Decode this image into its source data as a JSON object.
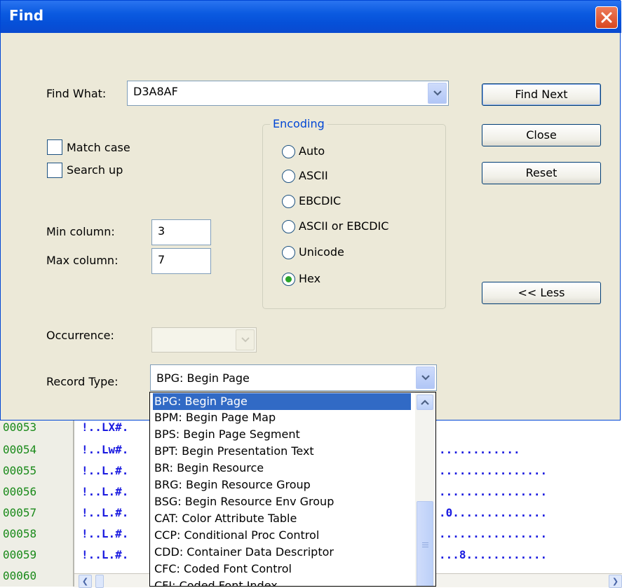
{
  "dialog": {
    "title": "Find",
    "find_what_label": "Find What:",
    "find_what_value": "D3A8AF",
    "match_case_label": "Match case",
    "search_up_label": "Search up",
    "min_column_label": "Min column:",
    "min_column_value": "3",
    "max_column_label": "Max column:",
    "max_column_value": "7",
    "occurrence_label": "Occurrence:",
    "record_type_label": "Record Type:",
    "record_type_value": "BPG: Begin Page",
    "encoding": {
      "title": "Encoding",
      "options": [
        "Auto",
        "ASCII",
        "EBCDIC",
        "ASCII or EBCDIC",
        "Unicode",
        "Hex"
      ],
      "selected": "Hex"
    },
    "buttons": {
      "find_next": "Find Next",
      "close": "Close",
      "reset": "Reset",
      "less": "<< Less"
    }
  },
  "record_type_list": {
    "selected": "BPG: Begin Page",
    "items": [
      "BPG: Begin Page",
      "BPM: Begin Page Map",
      "BPS: Begin Page Segment",
      "BPT: Begin Presentation Text",
      "BR:  Begin Resource",
      "BRG: Begin Resource Group",
      "BSG: Begin Resource Env Group",
      "CAT: Color Attribute Table",
      "CCP: Conditional Proc Control",
      "CDD: Container Data Descriptor",
      "CFC: Coded Font Control",
      "CFI: Coded Font Index"
    ]
  },
  "background": {
    "line_numbers": [
      "00053",
      "00054",
      "00055",
      "00056",
      "00057",
      "00058",
      "00059",
      "00060"
    ],
    "rows": [
      "!..LX#.",
      "!..Lw#.",
      "!..L.#.",
      "!..L.#.",
      "!..L.#.",
      "!..L.#.",
      "!..L.#.",
      ""
    ],
    "right_fragments": [
      "",
      "............",
      "................",
      "................",
      ".0..............",
      "................",
      "...8............",
      ""
    ]
  },
  "colors": {
    "title_bar": "#0a5ae0",
    "selection": "#316ac5",
    "line_number": "#1a8a1a",
    "record_text": "#1a1ae0"
  }
}
